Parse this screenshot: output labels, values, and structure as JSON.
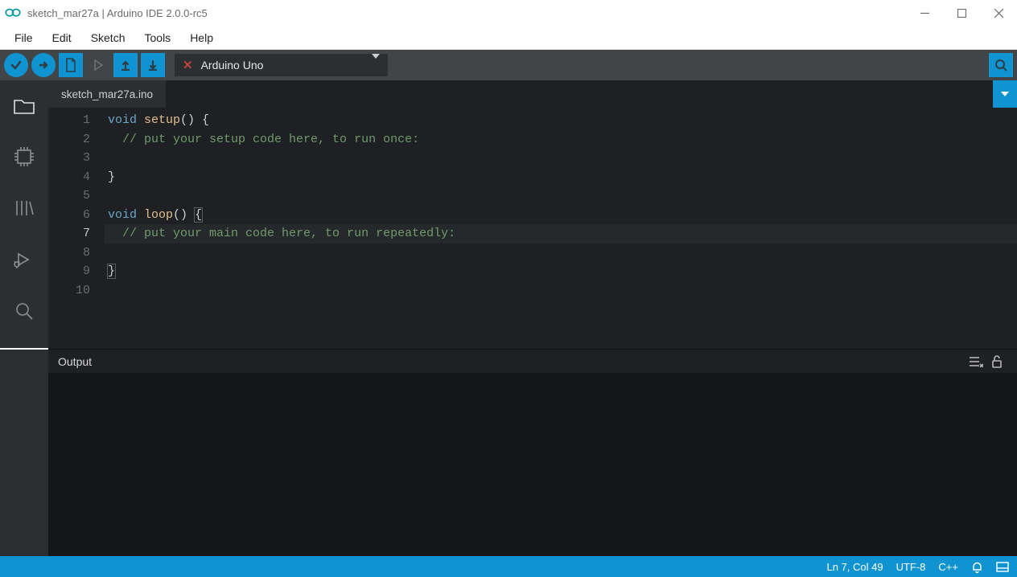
{
  "window": {
    "title": "sketch_mar27a | Arduino IDE 2.0.0-rc5"
  },
  "menu": {
    "items": [
      "File",
      "Edit",
      "Sketch",
      "Tools",
      "Help"
    ]
  },
  "board": {
    "name": "Arduino Uno"
  },
  "tabs": {
    "items": [
      {
        "label": "sketch_mar27a.ino"
      }
    ]
  },
  "editor": {
    "line_count": 10,
    "current_line": 7,
    "lines": {
      "l1_kw": "void",
      "l1_fn": "setup",
      "l1_rest": "() {",
      "l2_cmt": "// put your setup code here, to run once:",
      "l4_brace": "}",
      "l6_kw": "void",
      "l6_fn": "loop",
      "l6_rest": "() ",
      "l6_brace": "{",
      "l7_cmt": "// put your main code here, to run repeatedly:",
      "l9_brace": "}"
    }
  },
  "output": {
    "title": "Output"
  },
  "status": {
    "cursor": "Ln 7, Col 49",
    "encoding": "UTF-8",
    "lang": "C++"
  }
}
